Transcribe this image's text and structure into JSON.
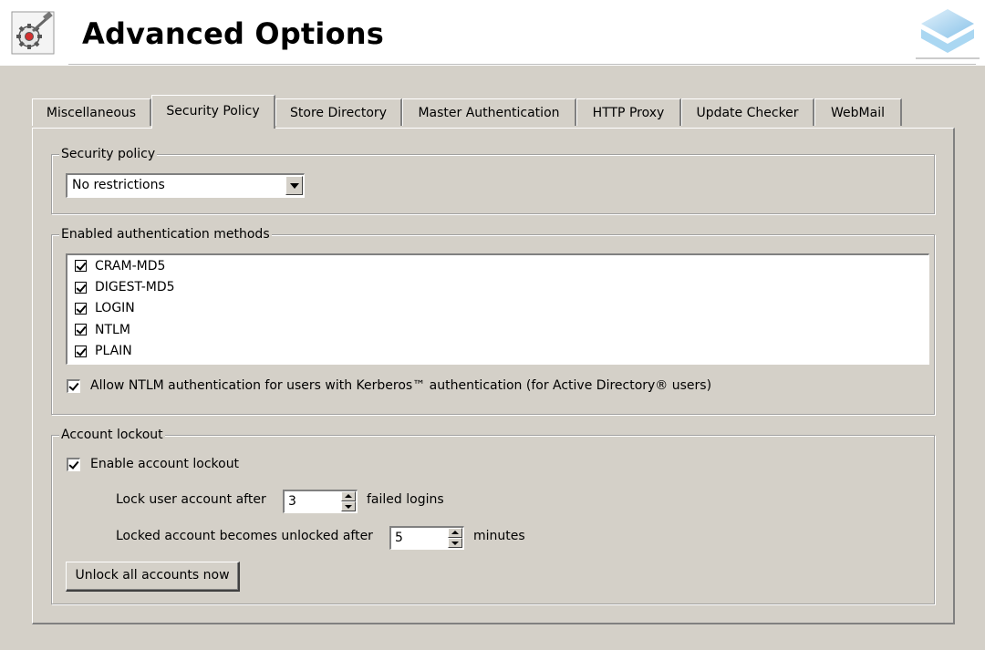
{
  "window": {
    "title": "Advanced Options"
  },
  "tabs": [
    {
      "label": "Miscellaneous",
      "active": false
    },
    {
      "label": "Security Policy",
      "active": true
    },
    {
      "label": "Store Directory",
      "active": false
    },
    {
      "label": "Master Authentication",
      "active": false
    },
    {
      "label": "HTTP Proxy",
      "active": false
    },
    {
      "label": "Update Checker",
      "active": false
    },
    {
      "label": "WebMail",
      "active": false
    }
  ],
  "security_policy": {
    "legend": "Security policy",
    "selected": "No restrictions"
  },
  "auth_methods": {
    "legend": "Enabled authentication methods",
    "items": [
      {
        "label": "CRAM-MD5",
        "checked": true
      },
      {
        "label": "DIGEST-MD5",
        "checked": true
      },
      {
        "label": "LOGIN",
        "checked": true
      },
      {
        "label": "NTLM",
        "checked": true
      },
      {
        "label": "PLAIN",
        "checked": true
      }
    ],
    "allow_ntlm_label": "Allow NTLM authentication for users with Kerberos™ authentication (for Active Directory® users)",
    "allow_ntlm_checked": true
  },
  "account_lockout": {
    "legend": "Account lockout",
    "enable_label": "Enable account lockout",
    "enable_checked": true,
    "lock_after_label": "Lock user account after",
    "lock_after_value": "3",
    "lock_after_suffix": "failed logins",
    "unlock_after_label": "Locked account becomes unlocked after",
    "unlock_after_value": "5",
    "unlock_after_suffix": "minutes",
    "unlock_all_button": "Unlock all accounts now"
  },
  "colors": {
    "dialog_bg": "#d4d0c8",
    "header_bg": "#ffffff",
    "logo_blue": "#5fa8dc"
  }
}
